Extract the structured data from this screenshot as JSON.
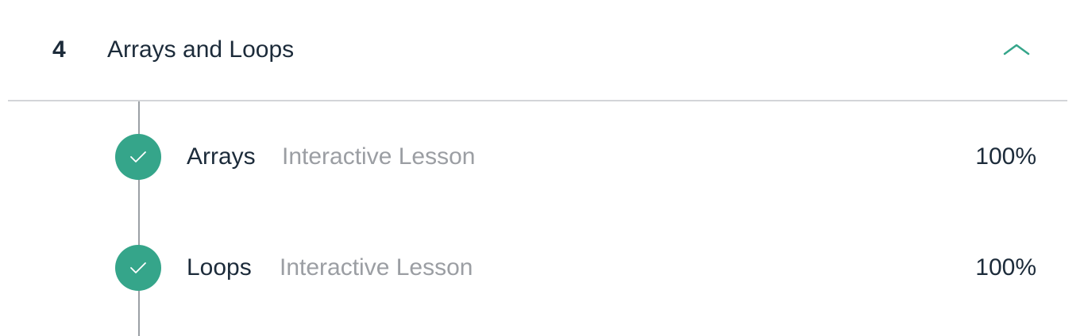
{
  "section": {
    "number": "4",
    "title": "Arrays and Loops",
    "toggle_icon": "chevron-up-icon",
    "accent_color": "#35a58a"
  },
  "lessons": [
    {
      "title": "Arrays",
      "type": "Interactive Lesson",
      "progress": "100%",
      "status_icon": "check-icon"
    },
    {
      "title": "Loops",
      "type": "Interactive Lesson",
      "progress": "100%",
      "status_icon": "check-icon"
    }
  ]
}
